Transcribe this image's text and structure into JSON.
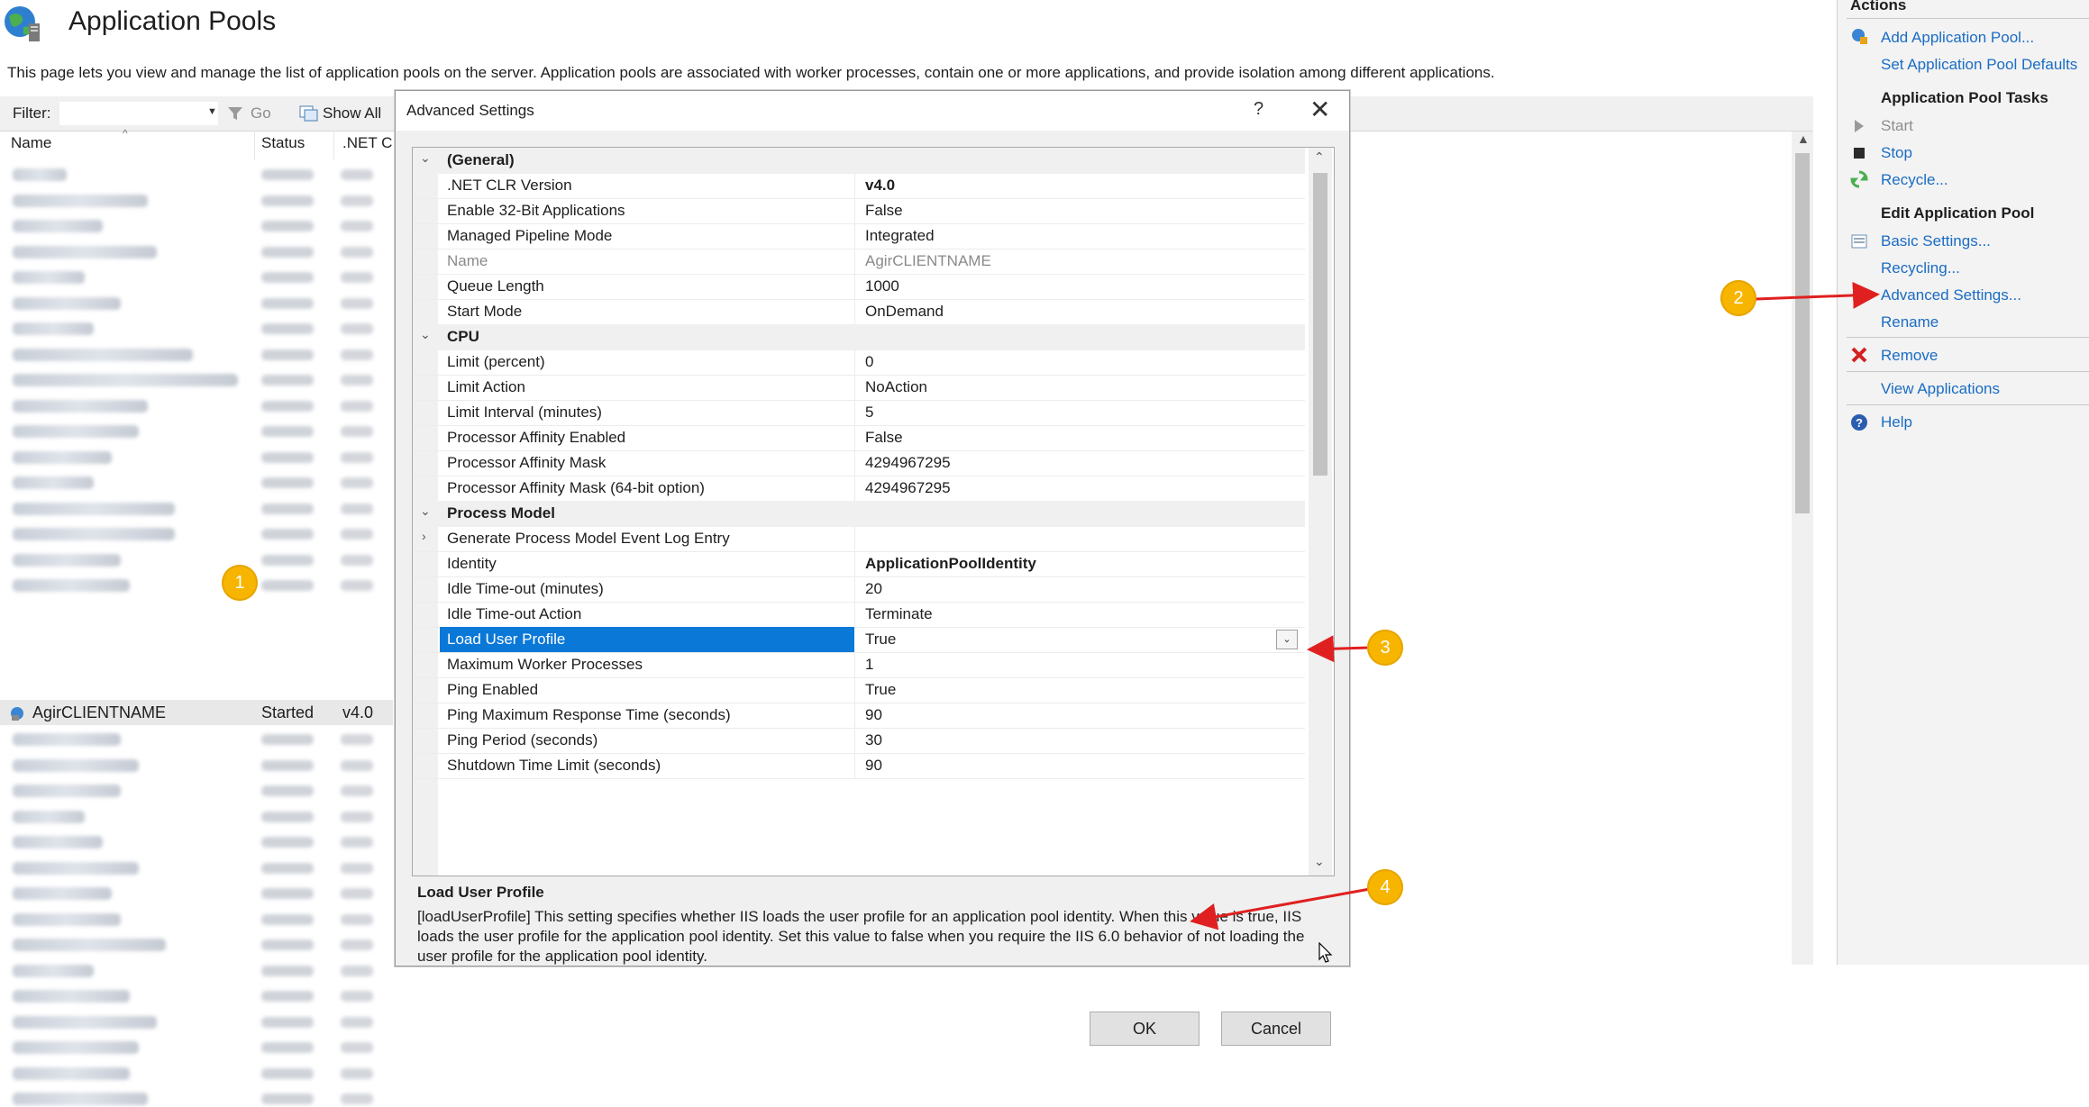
{
  "header": {
    "title": "Application Pools",
    "description": "This page lets you view and manage the list of application pools on the server. Application pools are associated with worker processes, contain one or more applications, and provide isolation among different applications."
  },
  "toolbar": {
    "filter_label": "Filter:",
    "go_label": "Go",
    "show_all_label": "Show All"
  },
  "list": {
    "columns": [
      "Name",
      "Status",
      ".NET C"
    ],
    "selected": {
      "name": "AgirCLIENTNAME",
      "status": "Started",
      "net": "v4.0"
    }
  },
  "actions": {
    "title": "Actions",
    "add_pool": "Add Application Pool...",
    "set_defaults": "Set Application Pool Defaults",
    "tasks_header": "Application Pool Tasks",
    "start": "Start",
    "stop": "Stop",
    "recycle": "Recycle...",
    "edit_header": "Edit Application Pool",
    "basic_settings": "Basic Settings...",
    "recycling": "Recycling...",
    "advanced_settings": "Advanced Settings...",
    "rename": "Rename",
    "remove": "Remove",
    "view_applications": "View Applications",
    "help": "Help"
  },
  "dialog": {
    "title": "Advanced Settings",
    "help": "?",
    "close": "✕",
    "categories": {
      "general": "(General)",
      "cpu": "CPU",
      "process_model": "Process Model"
    },
    "properties": [
      {
        "name": ".NET CLR Version",
        "value": "v4.0"
      },
      {
        "name": "Enable 32-Bit Applications",
        "value": "False"
      },
      {
        "name": "Managed Pipeline Mode",
        "value": "Integrated"
      },
      {
        "name": "Name",
        "value": "AgirCLIENTNAME"
      },
      {
        "name": "Queue Length",
        "value": "1000"
      },
      {
        "name": "Start Mode",
        "value": "OnDemand"
      },
      {
        "name": "Limit (percent)",
        "value": "0"
      },
      {
        "name": "Limit Action",
        "value": "NoAction"
      },
      {
        "name": "Limit Interval (minutes)",
        "value": "5"
      },
      {
        "name": "Processor Affinity Enabled",
        "value": "False"
      },
      {
        "name": "Processor Affinity Mask",
        "value": "4294967295"
      },
      {
        "name": "Processor Affinity Mask (64-bit option)",
        "value": "4294967295"
      },
      {
        "name": "Generate Process Model Event Log Entry",
        "value": ""
      },
      {
        "name": "Identity",
        "value": "ApplicationPoolIdentity"
      },
      {
        "name": "Idle Time-out (minutes)",
        "value": "20"
      },
      {
        "name": "Idle Time-out Action",
        "value": "Terminate"
      },
      {
        "name": "Load User Profile",
        "value": "True"
      },
      {
        "name": "Maximum Worker Processes",
        "value": "1"
      },
      {
        "name": "Ping Enabled",
        "value": "True"
      },
      {
        "name": "Ping Maximum Response Time (seconds)",
        "value": "90"
      },
      {
        "name": "Ping Period (seconds)",
        "value": "30"
      },
      {
        "name": "Shutdown Time Limit (seconds)",
        "value": "90"
      }
    ],
    "description_title": "Load User Profile",
    "description_text": "[loadUserProfile] This setting specifies whether IIS loads the user profile for an application pool identity. When this value is true, IIS loads the user profile for the application pool identity. Set this value to false when you require the IIS 6.0 behavior of not loading the user profile for the application pool identity.",
    "ok_label": "OK",
    "cancel_label": "Cancel"
  },
  "annotations": [
    "1",
    "2",
    "3",
    "4"
  ],
  "colors": {
    "selection": "#0a78d7",
    "link": "#1a6cc4",
    "badge": "#f7b500",
    "arrow": "#e02020"
  }
}
